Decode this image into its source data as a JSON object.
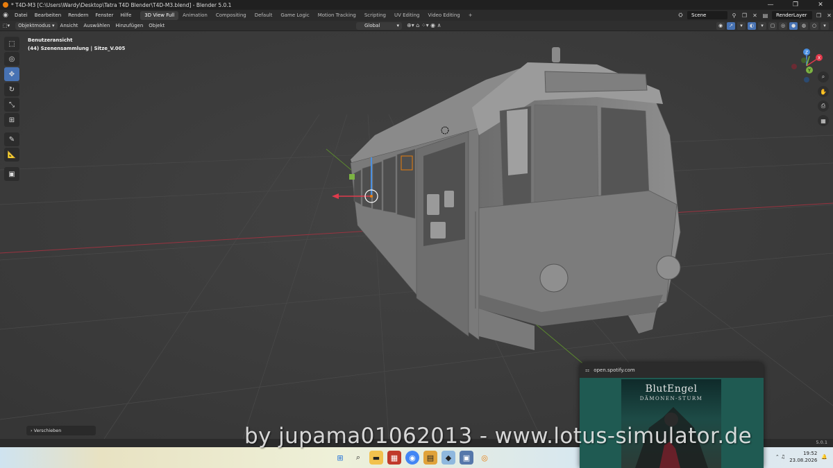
{
  "window": {
    "title": "* T4D-M3 [C:\\Users\\Wardy\\Desktop\\Tatra T4D Blender\\T4D-M3.blend] - Blender 5.0.1",
    "controls": [
      "—",
      "❐",
      "✕"
    ]
  },
  "menu": {
    "items": [
      "Datei",
      "Bearbeiten",
      "Rendern",
      "Fenster",
      "Hilfe"
    ],
    "workspaces": [
      "3D View Full",
      "Animation",
      "Compositing",
      "Default",
      "Game Logic",
      "Motion Tracking",
      "Scripting",
      "UV Editing",
      "Video Editing",
      "+"
    ],
    "active_workspace": "3D View Full",
    "scene": "Scene",
    "render_layer": "RenderLayer"
  },
  "header": {
    "mode": "Objektmodus",
    "items": [
      "Ansicht",
      "Auswählen",
      "Hinzufügen",
      "Objekt"
    ],
    "transform_orientation": "Global"
  },
  "viewport": {
    "view_name": "Benutzeransicht",
    "collection_info": "(44) Szenensammlung | Sitze_V.005",
    "last_operation": "Verschieben",
    "gizmo_axes": [
      "X",
      "Y",
      "Z"
    ]
  },
  "status": {
    "version": "5.0.1"
  },
  "watermark": "by jupama01062013 - www.lotus-simulator.de",
  "spotify_popup": {
    "url": "open.spotify.com",
    "album_artist": "BlutEngel",
    "album_title": "DÄMONEN-STURM"
  },
  "taskbar": {
    "time": "19:52",
    "date": "23.08.2026"
  },
  "colors": {
    "accent": "#4772b3",
    "viewport_bg": "#3d3d3d",
    "x_axis": "#c33a4a",
    "y_axis": "#7cb342"
  }
}
